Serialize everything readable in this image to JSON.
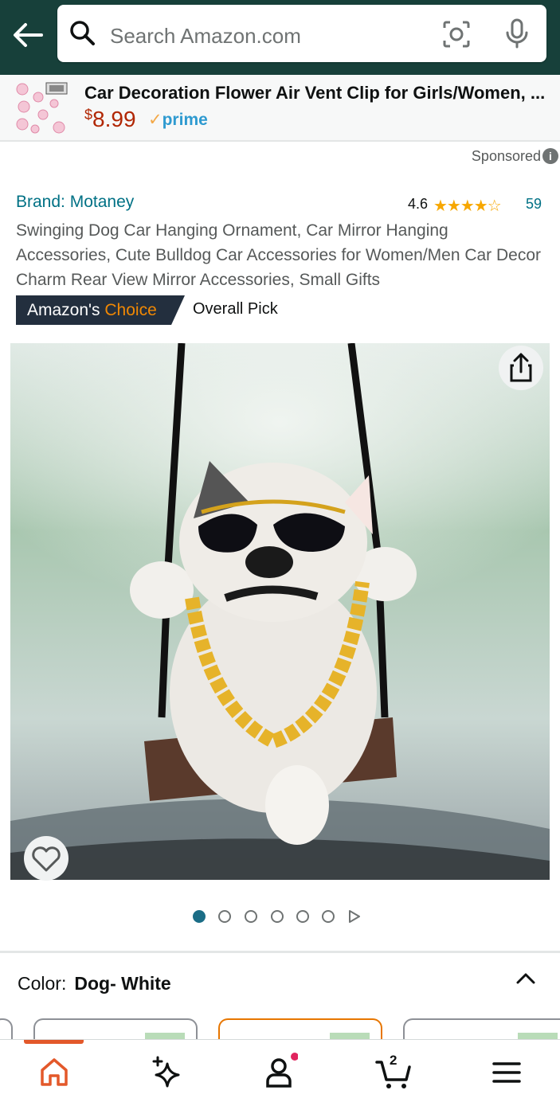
{
  "header": {
    "search_placeholder": "Search Amazon.com"
  },
  "sponsored_ad": {
    "title": "Car Decoration Flower Air Vent Clip for Girls/Women, ...",
    "price_currency": "$",
    "price_amount": "8.99",
    "prime_label": "prime",
    "sponsored_label": "Sponsored"
  },
  "product": {
    "brand": "Brand: Motaney",
    "rating": "4.6",
    "rating_value": 4.6,
    "review_count": "59",
    "title": "Swinging Dog Car Hanging Ornament, Car Mirror Hanging Accessories, Cute Bulldog Car Accessories for Women/Men Car Decor Charm Rear View Mirror Accessories, Small Gifts",
    "badge_prefix": "Amazon's ",
    "badge_highlight": "Choice",
    "badge_note": "Overall Pick"
  },
  "gallery": {
    "image_count": 6,
    "active_index": 0
  },
  "variation": {
    "label": "Color:",
    "value": "Dog- White"
  },
  "bottom_nav": {
    "cart_count": "2",
    "items": [
      "home-icon",
      "sparkle-icon",
      "account-icon",
      "cart-icon",
      "menu-icon"
    ]
  },
  "colors": {
    "header_bg": "#17403a",
    "price": "#b12704",
    "link": "#007185",
    "badge_bg": "#232f3e",
    "badge_accent": "#f08804",
    "active_tab": "#e3582a"
  }
}
